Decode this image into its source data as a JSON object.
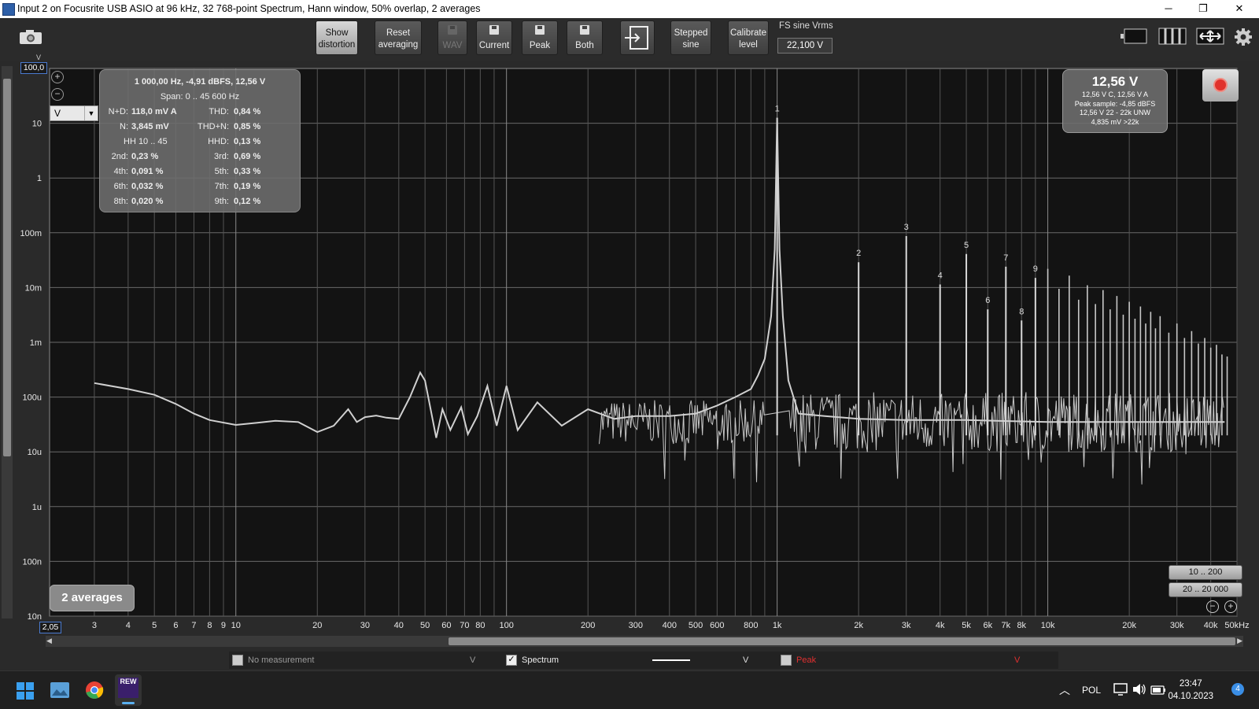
{
  "window": {
    "title": "Input 2 on Focusrite USB ASIO at 96 kHz, 32 768-point Spectrum, Hann window, 50% overlap, 2 averages",
    "minimize": "─",
    "maximize": "❐",
    "close": "✕"
  },
  "toolbar": {
    "show_distortion": [
      "Show",
      "distortion"
    ],
    "reset_averaging": [
      "Reset",
      "averaging"
    ],
    "wav": "WAV",
    "current": "Current",
    "peak": "Peak",
    "both": "Both",
    "stepped_sine": [
      "Stepped",
      "sine"
    ],
    "calibrate_level": [
      "Calibrate",
      "level"
    ],
    "fs_label": "FS sine Vrms",
    "fs_value": "22,100 V"
  },
  "plot": {
    "y_max_box": "100,0",
    "y_unit_top": "V",
    "unit_select": "V",
    "x_min_box": "2,05",
    "y_ticks": [
      "10",
      "1",
      "100m",
      "10m",
      "1m",
      "100u",
      "10u",
      "1u",
      "100n",
      "10n"
    ],
    "x_ticks": [
      "3",
      "4",
      "5",
      "6",
      "7",
      "8",
      "9",
      "10",
      "20",
      "30",
      "40",
      "50",
      "60",
      "70",
      "80",
      "100",
      "200",
      "300",
      "400",
      "500",
      "600",
      "800",
      "1k",
      "2k",
      "3k",
      "4k",
      "5k",
      "6k",
      "7k",
      "8k",
      "10k",
      "20k",
      "30k",
      "40k",
      "50kHz"
    ]
  },
  "distortion_panel": {
    "header": "1 000,00 Hz, -4,91 dBFS, 12,56 V",
    "span": "Span: 0 .. 45 600 Hz",
    "nd_label": "N+D:",
    "nd_value": "118,0 mV A",
    "thd_label": "THD:",
    "thd_value": "0,84 %",
    "n_label": "N:",
    "n_value": "3,845 mV",
    "thdn_label": "THD+N:",
    "thdn_value": "0,85 %",
    "hh_label": "HH 10 .. 45",
    "hhd_label": "HHD:",
    "hhd_value": "0,13 %",
    "h2_label": "2nd:",
    "h2_value": "0,23 %",
    "h3_label": "3rd:",
    "h3_value": "0,69 %",
    "h4_label": "4th:",
    "h4_value": "0,091 %",
    "h5_label": "5th:",
    "h5_value": "0,33 %",
    "h6_label": "6th:",
    "h6_value": "0,032 %",
    "h7_label": "7th:",
    "h7_value": "0,19 %",
    "h8_label": "8th:",
    "h8_value": "0,020 %",
    "h9_label": "9th:",
    "h9_value": "0,12 %"
  },
  "level_panel": {
    "value": "12,56 V",
    "line1": "12,56 V C, 12,56 V A",
    "line2": "Peak sample: -4,85 dBFS",
    "line3": "12,56 V 22 - 22k UNW",
    "line4": "4,835 mV >22k"
  },
  "averages_badge": "2 averages",
  "zoom_presets": [
    "10 .. 200",
    "20 .. 20 000"
  ],
  "legend": {
    "no_measurement": "No measurement",
    "no_measurement_unit": "V",
    "spectrum": "Spectrum",
    "spectrum_unit": "V",
    "peak": "Peak",
    "peak_unit": "V"
  },
  "taskbar": {
    "lang": "POL",
    "time": "23:47",
    "date": "04.10.2023",
    "notif": "4",
    "rew_label": "REW"
  },
  "chart_data": {
    "type": "line",
    "xlabel": "",
    "ylabel": "",
    "xscale": "log",
    "yscale": "log",
    "xlim": [
      2.05,
      50000
    ],
    "ylim": [
      1e-08,
      100
    ],
    "series": [
      {
        "name": "Spectrum",
        "color": "#c8c8c8",
        "x": [
          3,
          4,
          5,
          6,
          7,
          8,
          10,
          12,
          14,
          17,
          20,
          23,
          26,
          28,
          30,
          33,
          36,
          40,
          44,
          48,
          50,
          55,
          58,
          62,
          68,
          72,
          78,
          85,
          92,
          100,
          110,
          130,
          160,
          200,
          250,
          300,
          400,
          500,
          600,
          700,
          800,
          850,
          900,
          950,
          980,
          1000,
          1020,
          1050,
          1100,
          1200,
          1500,
          2000,
          3000,
          5000,
          10000,
          20000,
          30000,
          45000
        ],
        "y": [
          0.00018,
          0.00014,
          0.00011,
          7.5e-05,
          5e-05,
          3.8e-05,
          3.1e-05,
          3.4e-05,
          3.7e-05,
          3.5e-05,
          2.3e-05,
          3e-05,
          6e-05,
          3.5e-05,
          4.3e-05,
          4.6e-05,
          4.2e-05,
          4e-05,
          0.0001,
          0.00028,
          0.0002,
          1.8e-05,
          6e-05,
          2.5e-05,
          6.5e-05,
          2.1e-05,
          4.5e-05,
          0.00016,
          3e-05,
          0.00016,
          2.5e-05,
          8e-05,
          3e-05,
          6e-05,
          4e-05,
          4.5e-05,
          4.5e-05,
          5e-05,
          7e-05,
          0.0001,
          0.00014,
          0.00025,
          0.0005,
          0.003,
          0.05,
          12.56,
          0.05,
          0.003,
          0.0002,
          5e-05,
          4.5e-05,
          4e-05,
          3.8e-05,
          3.8e-05,
          3.5e-05,
          3.5e-05,
          3.5e-05,
          3.5e-05
        ]
      }
    ],
    "harmonics": [
      {
        "label": "1",
        "freq": 1000,
        "value": 12.56
      },
      {
        "label": "2",
        "freq": 2000,
        "value": 0.029
      },
      {
        "label": "3",
        "freq": 3000,
        "value": 0.087
      },
      {
        "label": "4",
        "freq": 4000,
        "value": 0.0114
      },
      {
        "label": "5",
        "freq": 5000,
        "value": 0.041
      },
      {
        "label": "6",
        "freq": 6000,
        "value": 0.004
      },
      {
        "label": "7",
        "freq": 7000,
        "value": 0.024
      },
      {
        "label": "8",
        "freq": 8000,
        "value": 0.0025
      },
      {
        "label": "9",
        "freq": 9000,
        "value": 0.015
      }
    ],
    "higher_harmonics": [
      {
        "freq": 10000,
        "value": 0.022
      },
      {
        "freq": 11000,
        "value": 0.0095
      },
      {
        "freq": 12000,
        "value": 0.0165
      },
      {
        "freq": 13000,
        "value": 0.006
      },
      {
        "freq": 14000,
        "value": 0.011
      },
      {
        "freq": 15000,
        "value": 0.005
      },
      {
        "freq": 16000,
        "value": 0.009
      },
      {
        "freq": 17000,
        "value": 0.004
      },
      {
        "freq": 18000,
        "value": 0.007
      },
      {
        "freq": 19000,
        "value": 0.0032
      },
      {
        "freq": 20000,
        "value": 0.0055
      },
      {
        "freq": 21000,
        "value": 0.0027
      },
      {
        "freq": 22000,
        "value": 0.0045
      },
      {
        "freq": 23000,
        "value": 0.0022
      },
      {
        "freq": 24000,
        "value": 0.0036
      },
      {
        "freq": 25000,
        "value": 0.0018
      },
      {
        "freq": 26000,
        "value": 0.003
      },
      {
        "freq": 28000,
        "value": 0.0015
      },
      {
        "freq": 30000,
        "value": 0.0022
      },
      {
        "freq": 32000,
        "value": 0.0012
      },
      {
        "freq": 34000,
        "value": 0.0016
      },
      {
        "freq": 36000,
        "value": 0.00095
      },
      {
        "freq": 38000,
        "value": 0.0012
      },
      {
        "freq": 40000,
        "value": 0.0008
      },
      {
        "freq": 42000,
        "value": 0.0009
      },
      {
        "freq": 44000,
        "value": 0.0006
      },
      {
        "freq": 46000,
        "value": 0.00055
      }
    ]
  }
}
